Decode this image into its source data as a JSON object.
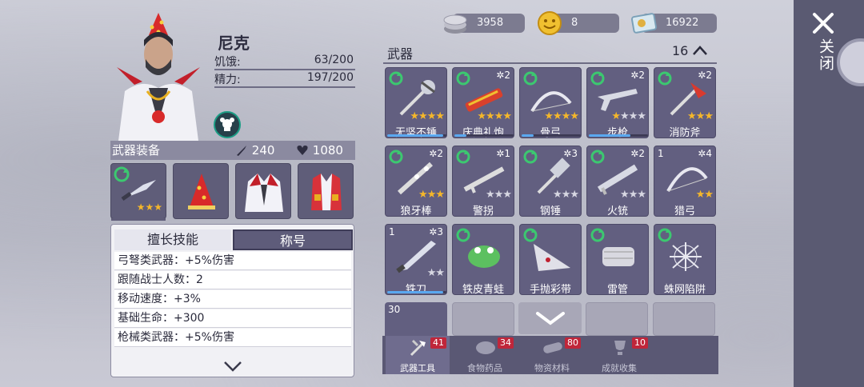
{
  "currency": [
    {
      "icon": "silver-coin-stack-icon",
      "value": "3958"
    },
    {
      "icon": "gold-coin-smiley-icon",
      "value": "8"
    },
    {
      "icon": "ticket-icon",
      "value": "16922"
    }
  ],
  "close_label": "关闭",
  "character": {
    "name": "尼克",
    "stats": [
      {
        "label": "饥饿:",
        "value": "63/200"
      },
      {
        "label": "精力:",
        "value": "197/200"
      }
    ]
  },
  "equipment": {
    "title": "武器装备",
    "attack": "240",
    "health": "1080",
    "slots": [
      {
        "name": "knife",
        "stars": 3
      },
      {
        "name": "party-hat"
      },
      {
        "name": "jacket"
      },
      {
        "name": "vest"
      }
    ]
  },
  "skills": {
    "tabs": [
      "擅长技能",
      "称号"
    ],
    "rows": [
      "弓弩类武器：+5%伤害",
      "跟随战士人数：2",
      "移动速度：+3%",
      "基础生命：+300",
      "枪械类武器：+5%伤害"
    ]
  },
  "weapons": {
    "title": "武器",
    "count": "16",
    "cards": [
      {
        "name": "无坚不锤",
        "up": "",
        "lvl": "",
        "stars": 4,
        "maxstars": 4,
        "swap": true,
        "bar": 0.95
      },
      {
        "name": "庆典礼炮",
        "up": "2",
        "lvl": "",
        "stars": 4,
        "maxstars": 4,
        "swap": true,
        "bar": 0.2
      },
      {
        "name": "骨弓",
        "up": "",
        "lvl": "",
        "stars": 4,
        "maxstars": 4,
        "swap": true,
        "bar": 0.2
      },
      {
        "name": "步枪",
        "up": "2",
        "lvl": "",
        "stars": 1,
        "maxstars": 4,
        "swap": true,
        "bar": 0.7
      },
      {
        "name": "消防斧",
        "up": "2",
        "lvl": "",
        "stars": 3,
        "maxstars": 3,
        "swap": true,
        "bar": 0
      },
      {
        "name": "狼牙棒",
        "up": "2",
        "lvl": "",
        "stars": 3,
        "maxstars": 3,
        "swap": true,
        "bar": 0
      },
      {
        "name": "警拐",
        "up": "1",
        "lvl": "",
        "stars": 0,
        "maxstars": 3,
        "swap": true,
        "bar": 0
      },
      {
        "name": "钢锤",
        "up": "3",
        "lvl": "",
        "stars": 0,
        "maxstars": 3,
        "swap": true,
        "bar": 0
      },
      {
        "name": "火铳",
        "up": "2",
        "lvl": "",
        "stars": 0,
        "maxstars": 3,
        "swap": true,
        "bar": 0
      },
      {
        "name": "猎弓",
        "up": "4",
        "lvl": "1",
        "stars": 2,
        "maxstars": 2,
        "swap": false,
        "bar": 0
      },
      {
        "name": "铁刀",
        "up": "3",
        "lvl": "1",
        "stars": 0,
        "maxstars": 2,
        "swap": false,
        "bar": 0.95
      },
      {
        "name": "铁皮青蛙",
        "up": "",
        "lvl": "",
        "stars": 0,
        "maxstars": 0,
        "swap": true,
        "bar": 0
      },
      {
        "name": "手抛彩带",
        "up": "",
        "lvl": "",
        "stars": 0,
        "maxstars": 0,
        "swap": true,
        "bar": 0
      },
      {
        "name": "雷管",
        "up": "",
        "lvl": "",
        "stars": 0,
        "maxstars": 0,
        "swap": true,
        "bar": 0
      },
      {
        "name": "蛛网陷阱",
        "up": "",
        "lvl": "",
        "stars": 0,
        "maxstars": 0,
        "swap": true,
        "bar": 0
      }
    ],
    "bottom_first_level": "30"
  },
  "bottom_tabs": [
    {
      "label": "武器工具",
      "badge": "41",
      "icon": "axe-hammer-icon",
      "active": true
    },
    {
      "label": "食物药品",
      "badge": "34",
      "icon": "meat-icon",
      "active": false
    },
    {
      "label": "物资材料",
      "badge": "80",
      "icon": "wood-log-icon",
      "active": false
    },
    {
      "label": "成就收集",
      "badge": "10",
      "icon": "trophy-icon",
      "active": false
    }
  ],
  "colors": {
    "accent_gold": "#f5b72a",
    "panel": "#625f80",
    "badge_red": "#c0263a"
  }
}
